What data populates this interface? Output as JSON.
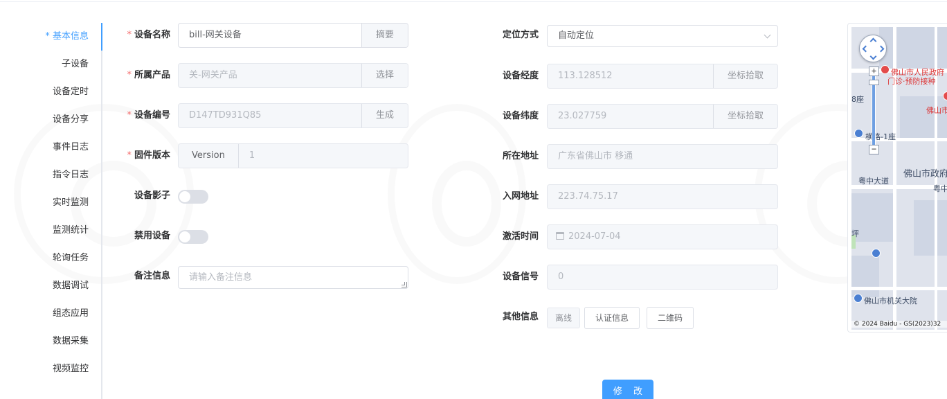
{
  "sidebar": {
    "items": [
      {
        "label": "* 基本信息",
        "active": true
      },
      {
        "label": "子设备"
      },
      {
        "label": "设备定时"
      },
      {
        "label": "设备分享"
      },
      {
        "label": "事件日志"
      },
      {
        "label": "指令日志"
      },
      {
        "label": "实时监测"
      },
      {
        "label": "监测统计"
      },
      {
        "label": "轮询任务"
      },
      {
        "label": "数据调试"
      },
      {
        "label": "组态应用"
      },
      {
        "label": "数据采集"
      },
      {
        "label": "视频监控"
      }
    ]
  },
  "form": {
    "device_name": {
      "label": "设备名称",
      "required": true,
      "value": "bill-网关设备",
      "append": "摘要"
    },
    "product": {
      "label": "所属产品",
      "required": true,
      "value": "关-网关产品",
      "append": "选择"
    },
    "serial": {
      "label": "设备编号",
      "required": true,
      "value": "D147TD931Q85",
      "append": "生成"
    },
    "firmware": {
      "label": "固件版本",
      "required": true,
      "prepend": "Version",
      "value": "1"
    },
    "shadow": {
      "label": "设备影子",
      "enabled": false
    },
    "disable": {
      "label": "禁用设备",
      "enabled": false
    },
    "remark": {
      "label": "备注信息",
      "placeholder": "请输入备注信息"
    },
    "locate": {
      "label": "定位方式",
      "value": "自动定位"
    },
    "longitude": {
      "label": "设备经度",
      "value": "113.128512",
      "append": "坐标拾取"
    },
    "latitude": {
      "label": "设备纬度",
      "value": "23.027759",
      "append": "坐标拾取"
    },
    "address": {
      "label": "所在地址",
      "value": "广东省佛山市 移通"
    },
    "net_address": {
      "label": "入网地址",
      "value": "223.74.75.17"
    },
    "activate_time": {
      "label": "激活时间",
      "value": "2024-07-04"
    },
    "signal": {
      "label": "设备信号",
      "value": "0"
    },
    "other": {
      "label": "其他信息",
      "status": "离线",
      "auth_btn": "认证信息",
      "qr_btn": "二维码"
    },
    "submit": "修 改"
  },
  "map": {
    "labels": {
      "gov": "佛山市人民政府",
      "clinic": "门诊·预防接种",
      "city_red": "佛山市",
      "seat8": "8座",
      "henglu": "横路-1座",
      "gov2": "佛山市政府",
      "road1": "粤中大道",
      "road1b": "粤中",
      "ping": "坪",
      "court": "佛山市机关大院"
    },
    "copyright": "© 2024 Baidu - GS(2023)32",
    "zoom_in": "+",
    "zoom_out": "−"
  }
}
